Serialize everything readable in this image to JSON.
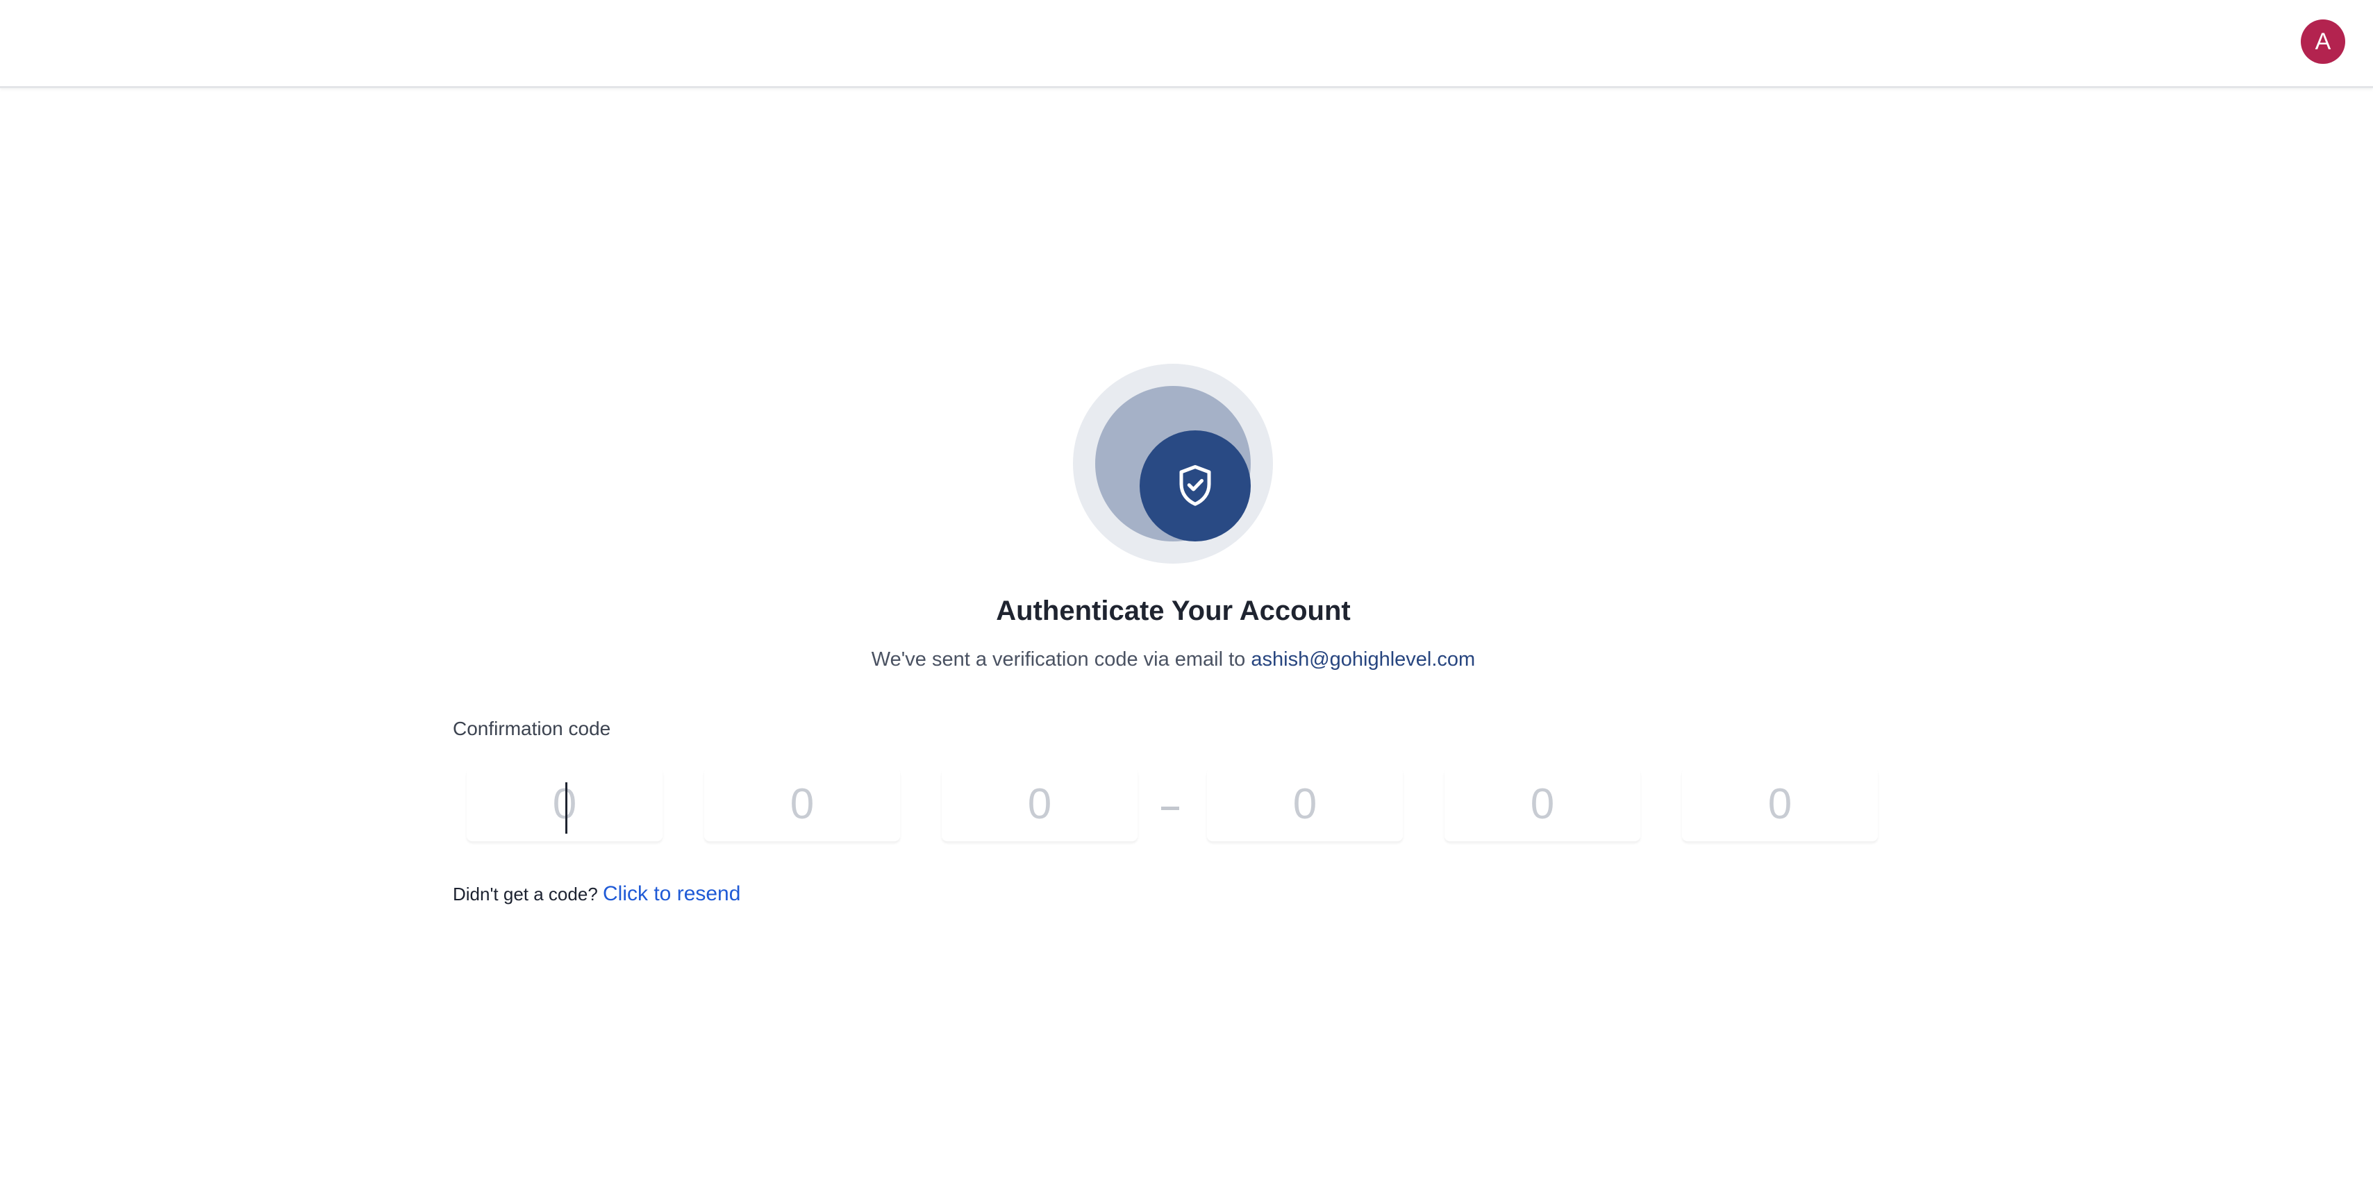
{
  "header": {
    "avatar_initial": "A",
    "avatar_color": "#b3234f"
  },
  "hero": {
    "icon": "shield-check-icon",
    "core_color": "#294a84"
  },
  "auth": {
    "title": "Authenticate Your Account",
    "subtitle_prefix": "We've sent a verification code via email to ",
    "email": "ashish@gohighlevel.com",
    "code_label": "Confirmation code",
    "code_placeholders": [
      "0",
      "0",
      "0",
      "0",
      "0",
      "0"
    ],
    "resend_prompt": "Didn't get a code?",
    "resend_link": "Click to resend"
  },
  "colors": {
    "link": "#1f5ad6",
    "email": "#27457f"
  }
}
